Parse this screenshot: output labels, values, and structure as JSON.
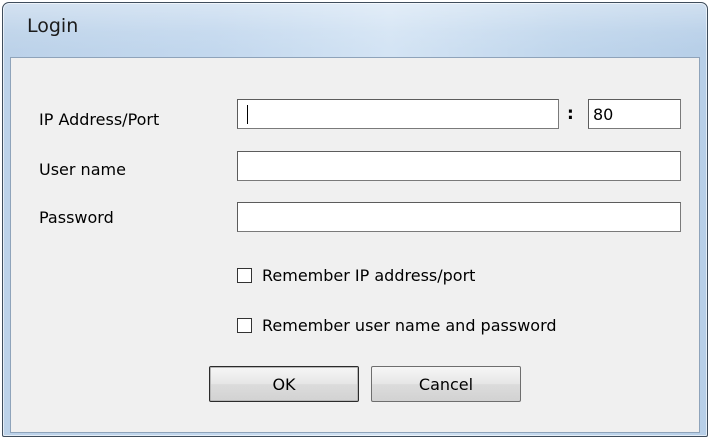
{
  "window": {
    "title": "Login"
  },
  "form": {
    "ip_label": "IP Address/Port",
    "ip_value": "",
    "port_separator": ":",
    "port_value": "80",
    "username_label": "User name",
    "username_value": "",
    "password_label": "Password",
    "password_value": ""
  },
  "options": {
    "remember_ip": {
      "label": "Remember IP address/port",
      "checked": false
    },
    "remember_credentials": {
      "label": "Remember user name and password",
      "checked": false
    }
  },
  "buttons": {
    "ok_label": "OK",
    "cancel_label": "Cancel"
  }
}
